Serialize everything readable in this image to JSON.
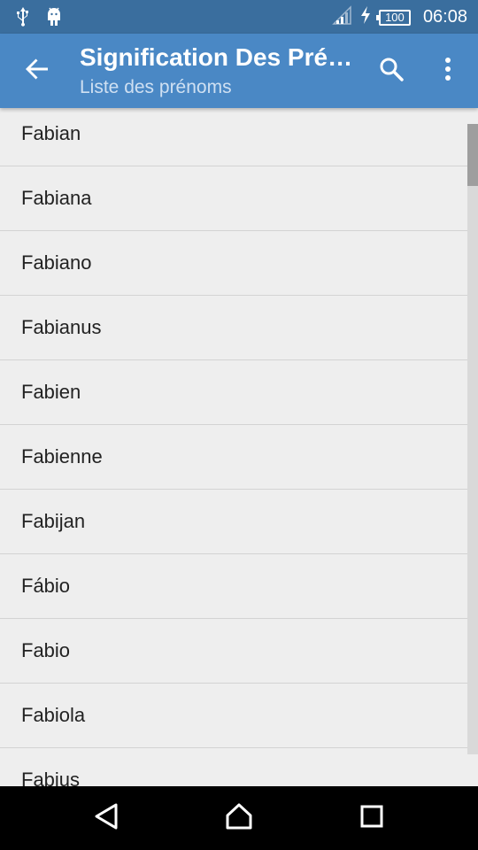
{
  "status_bar": {
    "time": "06:08",
    "battery_level": "100",
    "left_icons": [
      "usb-icon",
      "android-debug-icon"
    ],
    "right_icons": [
      "signal-icon",
      "charging-icon",
      "battery-icon"
    ]
  },
  "app_bar": {
    "title": "Signification Des Pré…",
    "subtitle": "Liste des prénoms",
    "actions": [
      "back-arrow-icon",
      "search-icon",
      "more-vert-icon"
    ]
  },
  "list": {
    "items": [
      {
        "label": "Fabian"
      },
      {
        "label": "Fabiana"
      },
      {
        "label": "Fabiano"
      },
      {
        "label": "Fabianus"
      },
      {
        "label": "Fabien"
      },
      {
        "label": "Fabienne"
      },
      {
        "label": "Fabijan"
      },
      {
        "label": "Fábio"
      },
      {
        "label": "Fabio"
      },
      {
        "label": "Fabiola"
      },
      {
        "label": "Fabius"
      }
    ]
  },
  "nav_bar": {
    "buttons": [
      "back-triangle-icon",
      "home-icon",
      "recents-icon"
    ]
  },
  "colors": {
    "status_bar": "#3a6e9e",
    "app_bar": "#4a88c5",
    "background": "#eeeeee",
    "divider": "#d3d3d3",
    "nav_bar": "#000000"
  }
}
